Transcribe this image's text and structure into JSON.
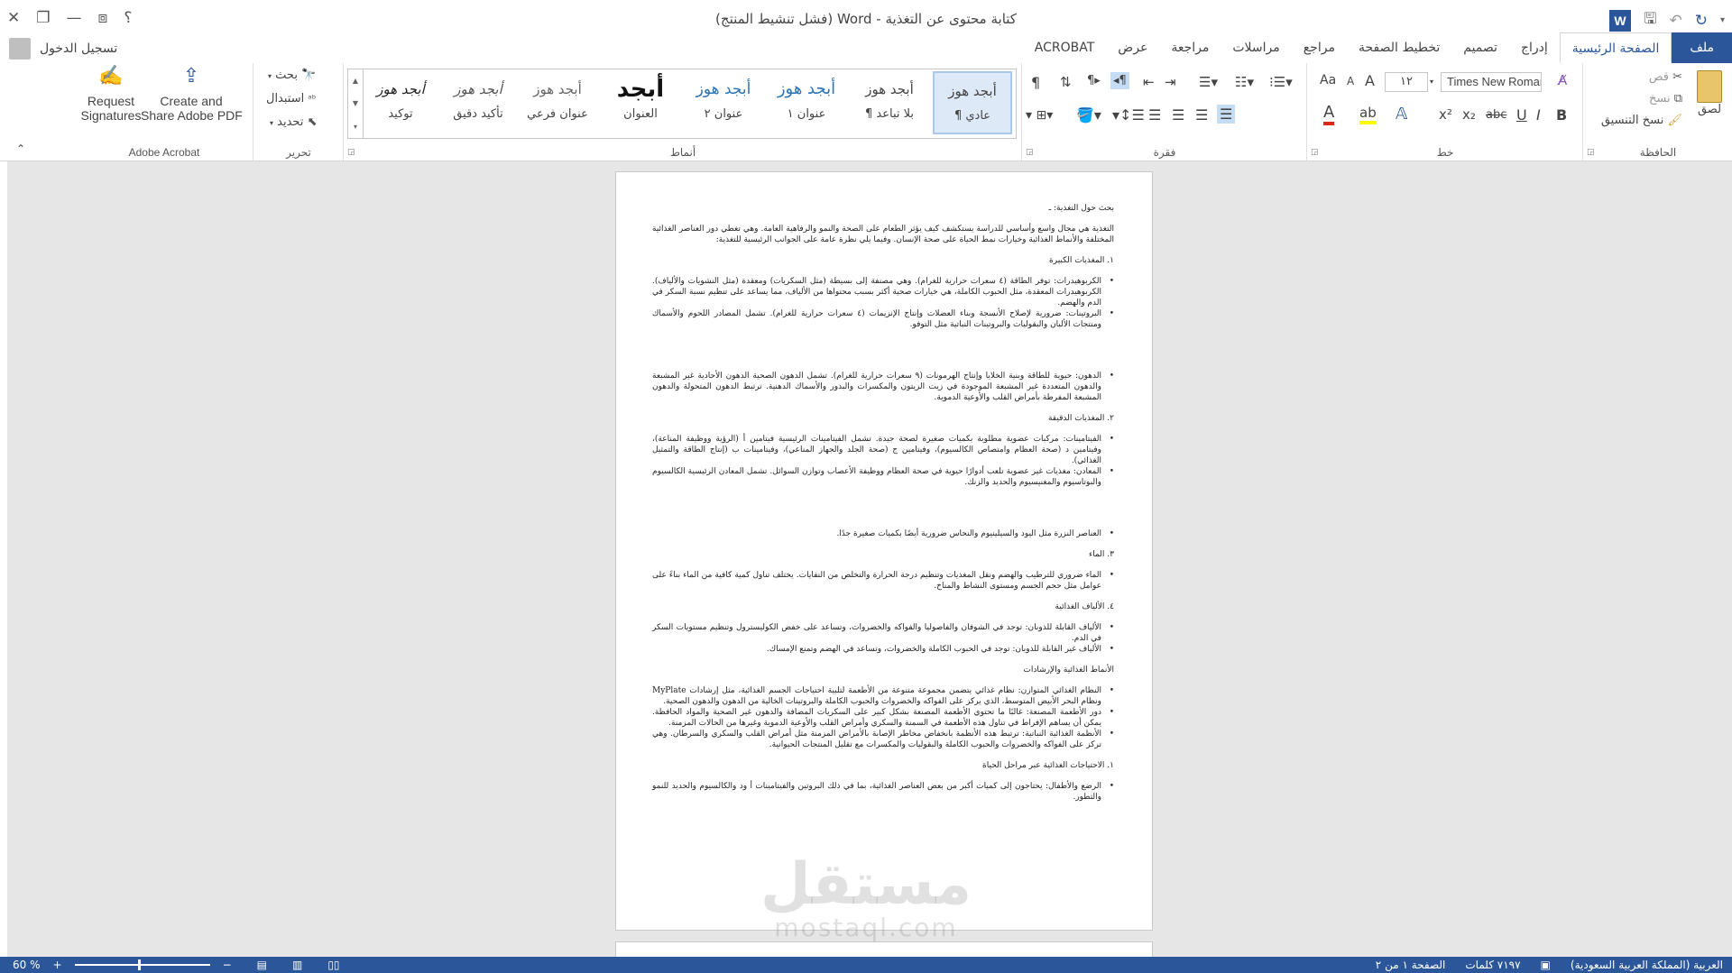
{
  "window": {
    "title": "كتابة محتوى عن التغذية - Word (فشل تنشيط المنتج)",
    "controls": {
      "help": "؟",
      "ribbon_options": "⧈",
      "restore": "❐",
      "minimize": "—",
      "close": "✕"
    }
  },
  "qat": {
    "icons": [
      "word-logo",
      "save-icon",
      "undo-icon",
      "redo-icon",
      "customize-icon"
    ],
    "word_logo_letter": "W"
  },
  "account": {
    "signin": "تسجيل الدخول"
  },
  "tabs": [
    "ملف",
    "الصفحة الرئيسية",
    "إدراج",
    "تصميم",
    "تخطيط الصفحة",
    "مراجع",
    "مراسلات",
    "مراجعة",
    "عرض",
    "ACROBAT"
  ],
  "ribbon": {
    "clipboard": {
      "label": "الحافظة",
      "paste": "لصق",
      "cut": "قص",
      "copy": "نسخ",
      "format_painter": "نسخ التنسيق"
    },
    "font": {
      "label": "خط",
      "font_name": "Times New Roman",
      "font_size": "١٢",
      "grow": "A",
      "shrink": "A",
      "change_case": "Aa",
      "bold": "B",
      "italic": "I",
      "underline": "U",
      "strike": "abc",
      "subscript": "x₂",
      "superscript": "x²"
    },
    "paragraph": {
      "label": "فقرة"
    },
    "styles": {
      "label": "أنماط",
      "items": [
        {
          "sample": "أبجد هوز",
          "name": "¶ عادي"
        },
        {
          "sample": "أبجد هوز",
          "name": "¶ بلا تباعد"
        },
        {
          "sample": "أبجد هوز",
          "name": "عنوان ١"
        },
        {
          "sample": "أبجد هوز",
          "name": "عنوان ٢"
        },
        {
          "sample": "أبجد",
          "name": "العنوان"
        },
        {
          "sample": "أبجد هوز",
          "name": "عنوان فرعي"
        },
        {
          "sample": "أبجد هوز",
          "name": "تأكيد دقيق"
        },
        {
          "sample": "أبجد هوز",
          "name": "توكيد"
        }
      ]
    },
    "editing": {
      "label": "تحرير",
      "find": "بحث",
      "replace": "استبدال",
      "select": "تحديد"
    },
    "acrobat": {
      "label": "Adobe Acrobat",
      "create_line1": "Create and",
      "create_line2": "Share Adobe PDF",
      "request_line1": "Request",
      "request_line2": "Signatures"
    }
  },
  "document": {
    "title": "بحث حول التغذية: ـ",
    "intro": "التغذية هي مجال واسع وأساسي للدراسة يستكشف كيف يؤثر الطعام على الصحة والنمو والرفاهية العامة. وهي تغطي دور العناصر الغذائية المختلفة والأنماط الغذائية وخيارات نمط الحياة على صحة الإنسان. وفيما يلي نظرة عامة على الجوانب الرئيسية للتغذية:",
    "h1": "١.   المغذيات الكبيرة",
    "b1": "الكربوهيدرات: توفر الطاقة (٤ سعرات حرارية للغرام). وهي مصنفة إلى بسيطة (مثل السكريات) ومعقدة (مثل النشويات والألياف). الكربوهيدرات المعقدة، مثل الحبوب الكاملة، هي خيارات صحية أكثر بسبب محتواها من الألياف، مما يساعد على تنظيم نسبة السكر في الدم والهضم.",
    "b2": "البروتينات: ضرورية لإصلاح الأنسجة وبناء العضلات وإنتاج الإنزيمات (٤ سعرات حرارية للغرام). تشمل المصادر اللحوم والأسماك ومنتجات الألبان والبقوليات والبروتينات النباتية مثل التوفو.",
    "b3": "الدهون: حيوية للطاقة وبنية الخلايا وإنتاج الهرمونات (٩ سعرات حرارية للغرام). تشمل الدهون الصحية الدهون الأحادية غير المشبعة والدهون المتعددة غير المشبعة الموجودة في زيت الزيتون والمكسرات والبذور والأسماك الدهنية. ترتبط الدهون المتحولة والدهون المشبعة المفرطة بأمراض القلب والأوعية الدموية.",
    "h2": "٢.   المغذيات الدقيقة",
    "b4": "الفيتامينات: مركبات عضوية مطلوبة بكميات صغيرة لصحة جيدة. تشمل الفيتامينات الرئيسية فيتامين أ (الرؤية ووظيفة المناعة)، وفيتامين د (صحة العظام وامتصاص الكالسيوم)، وفيتامين ج (صحة الجلد والجهاز المناعي)، وفيتامينات ب (إنتاج الطاقة والتمثيل الغذائي).",
    "b5": "المعادن: مغذيات غير عضوية تلعب أدوارًا حيوية في صحة العظام ووظيفة الأعصاب وتوازن السوائل. تشمل المعادن الرئيسية الكالسيوم والبوتاسيوم والمغنيسيوم والحديد والزنك.",
    "b6": "العناصر النزرة مثل اليود والسيلينيوم والنحاس ضرورية أيضًا بكميات صغيرة جدًا.",
    "h3": "٣.   الماء",
    "b7": "الماء ضروري للترطيب والهضم ونقل المغذيات وتنظيم درجة الحرارة والتخلص من النفايات. يختلف تناول كمية كافية من الماء بناءً على عوامل مثل حجم الجسم ومستوى النشاط والمناخ.",
    "h4": "٤.   الألياف الغذائية",
    "b8": "الألياف القابلة للذوبان: توجد في الشوفان والفاصوليا والفواكه والخضروات، وتساعد على خفض الكوليسترول وتنظيم مستويات السكر في الدم.",
    "b9": "الألياف غير القابلة للذوبان: توجد في الحبوب الكاملة والخضروات، وتساعد في الهضم وتمنع الإمساك.",
    "h5": "الأنماط الغذائية والإرشادات",
    "b10": "النظام الغذائي المتوازن: نظام غذائي يتضمن مجموعة متنوعة من الأطعمة لتلبية احتياجات الجسم الغذائية، مثل إرشادات MyPlate ونظام البحر الأبيض المتوسط، الذي يركز على الفواكه والخضروات والحبوب الكاملة والبروتينات الخالية من الدهون والدهون الصحية.",
    "b11": "دور الأطعمة المصنعة: غالبًا ما تحتوي الأطعمة المصنعة بشكل كبير على السكريات المضافة والدهون غير الصحية والمواد الحافظة. يمكن أن يساهم الإفراط في تناول هذه الأطعمة في السمنة والسكري وأمراض القلب والأوعية الدموية وغيرها من الحالات المزمنة.",
    "b12": "الأنظمة الغذائية النباتية: ترتبط هذه الأنظمة بانخفاض مخاطر الإصابة بالأمراض المزمنة مثل أمراض القلب والسكري والسرطان. وهي تركز على الفواكه والخضروات والحبوب الكاملة والبقوليات والمكسرات مع تقليل المنتجات الحيوانية.",
    "h6": "١.   الاحتياجات الغذائية عبر مراحل الحياة",
    "b13": "الرضع والأطفال: يحتاجون إلى كميات أكبر من بعض العناصر الغذائية، بما في ذلك البروتين والفيتامينات أ ود والكالسيوم والحديد للنمو والتطور."
  },
  "watermark": {
    "line1": "مستقل",
    "line2": "mostaql.com"
  },
  "status": {
    "page": "الصفحة ١ من ٢",
    "words": "٧١٩٧ كلمات",
    "language": "العربية (المملكة العربية السعودية)",
    "zoom": "60 %",
    "zoom_level": 0.6
  },
  "colors": {
    "accent": "#2b579a",
    "status_bg": "#2b579a"
  }
}
